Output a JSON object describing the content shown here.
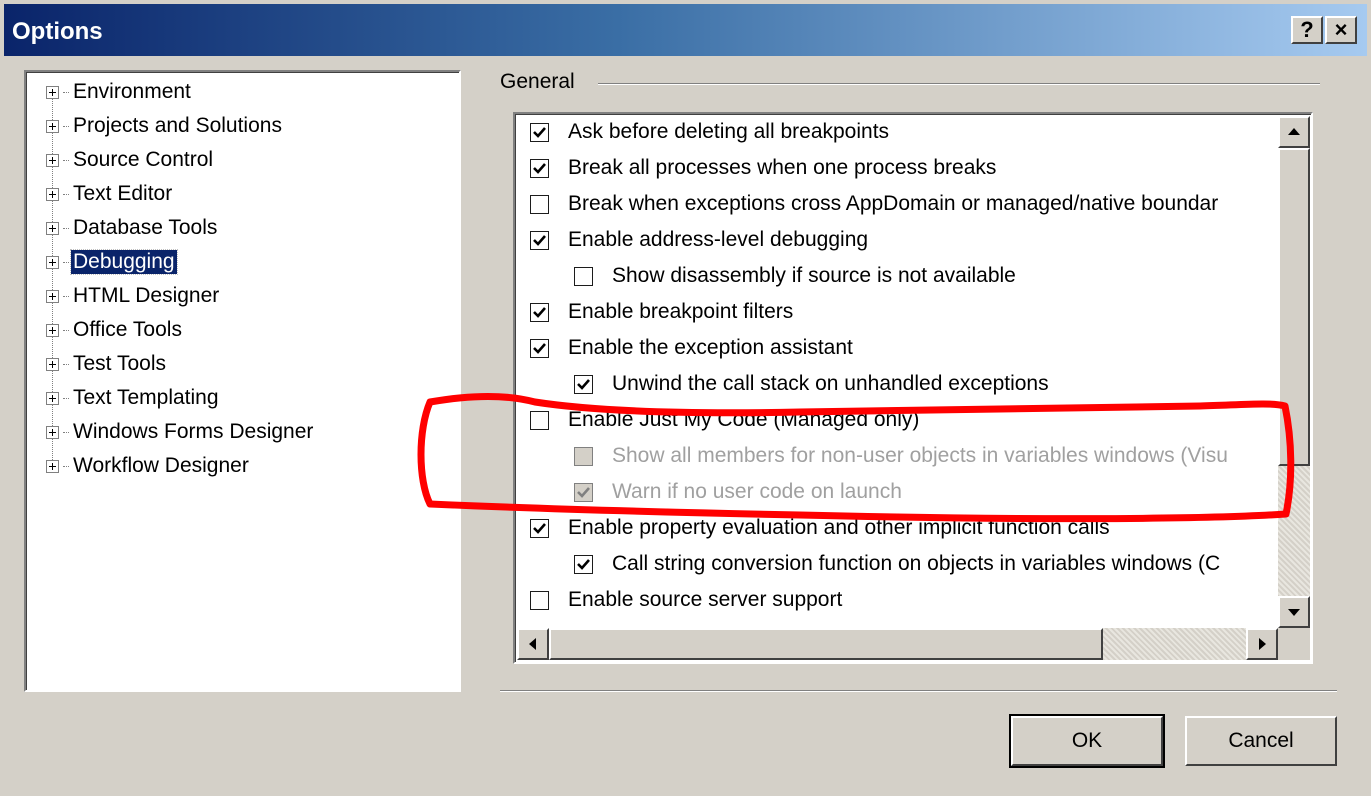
{
  "window": {
    "title": "Options",
    "help_button": "?",
    "close_button": "×"
  },
  "tree": {
    "items": [
      {
        "label": "Environment",
        "selected": false
      },
      {
        "label": "Projects and Solutions",
        "selected": false
      },
      {
        "label": "Source Control",
        "selected": false
      },
      {
        "label": "Text Editor",
        "selected": false
      },
      {
        "label": "Database Tools",
        "selected": false
      },
      {
        "label": "Debugging",
        "selected": true
      },
      {
        "label": "HTML Designer",
        "selected": false
      },
      {
        "label": "Office Tools",
        "selected": false
      },
      {
        "label": "Test Tools",
        "selected": false
      },
      {
        "label": "Text Templating",
        "selected": false
      },
      {
        "label": "Windows Forms Designer",
        "selected": false
      },
      {
        "label": "Workflow Designer",
        "selected": false
      }
    ]
  },
  "general": {
    "group_label": "General",
    "options": [
      {
        "label": "Ask before deleting all breakpoints",
        "checked": true,
        "indent": 0,
        "enabled": true
      },
      {
        "label": "Break all processes when one process breaks",
        "checked": true,
        "indent": 0,
        "enabled": true
      },
      {
        "label": "Break when exceptions cross AppDomain or managed/native boundar",
        "checked": false,
        "indent": 0,
        "enabled": true
      },
      {
        "label": "Enable address-level debugging",
        "checked": true,
        "indent": 0,
        "enabled": true
      },
      {
        "label": "Show disassembly if source is not available",
        "checked": false,
        "indent": 1,
        "enabled": true
      },
      {
        "label": "Enable breakpoint filters",
        "checked": true,
        "indent": 0,
        "enabled": true
      },
      {
        "label": "Enable the exception assistant",
        "checked": true,
        "indent": 0,
        "enabled": true
      },
      {
        "label": "Unwind the call stack on unhandled exceptions",
        "checked": true,
        "indent": 1,
        "enabled": true
      },
      {
        "label": "Enable Just My Code (Managed only)",
        "checked": false,
        "indent": 0,
        "enabled": true
      },
      {
        "label": "Show all members for non-user objects in variables windows (Visu",
        "checked": false,
        "indent": 1,
        "enabled": false
      },
      {
        "label": "Warn if no user code on launch",
        "checked": true,
        "indent": 1,
        "enabled": false
      },
      {
        "label": "Enable property evaluation and other implicit function calls",
        "checked": true,
        "indent": 0,
        "enabled": true
      },
      {
        "label": "Call string conversion function on objects in variables windows (C",
        "checked": true,
        "indent": 1,
        "enabled": true
      },
      {
        "label": "Enable source server support",
        "checked": false,
        "indent": 0,
        "enabled": true
      }
    ]
  },
  "buttons": {
    "ok": "OK",
    "cancel": "Cancel"
  },
  "colors": {
    "title_gradient_start": "#0a246a",
    "title_gradient_end": "#a6caf0",
    "dialog_face": "#d4d0c8",
    "selection": "#0a246a",
    "annotation": "#ff0000"
  }
}
